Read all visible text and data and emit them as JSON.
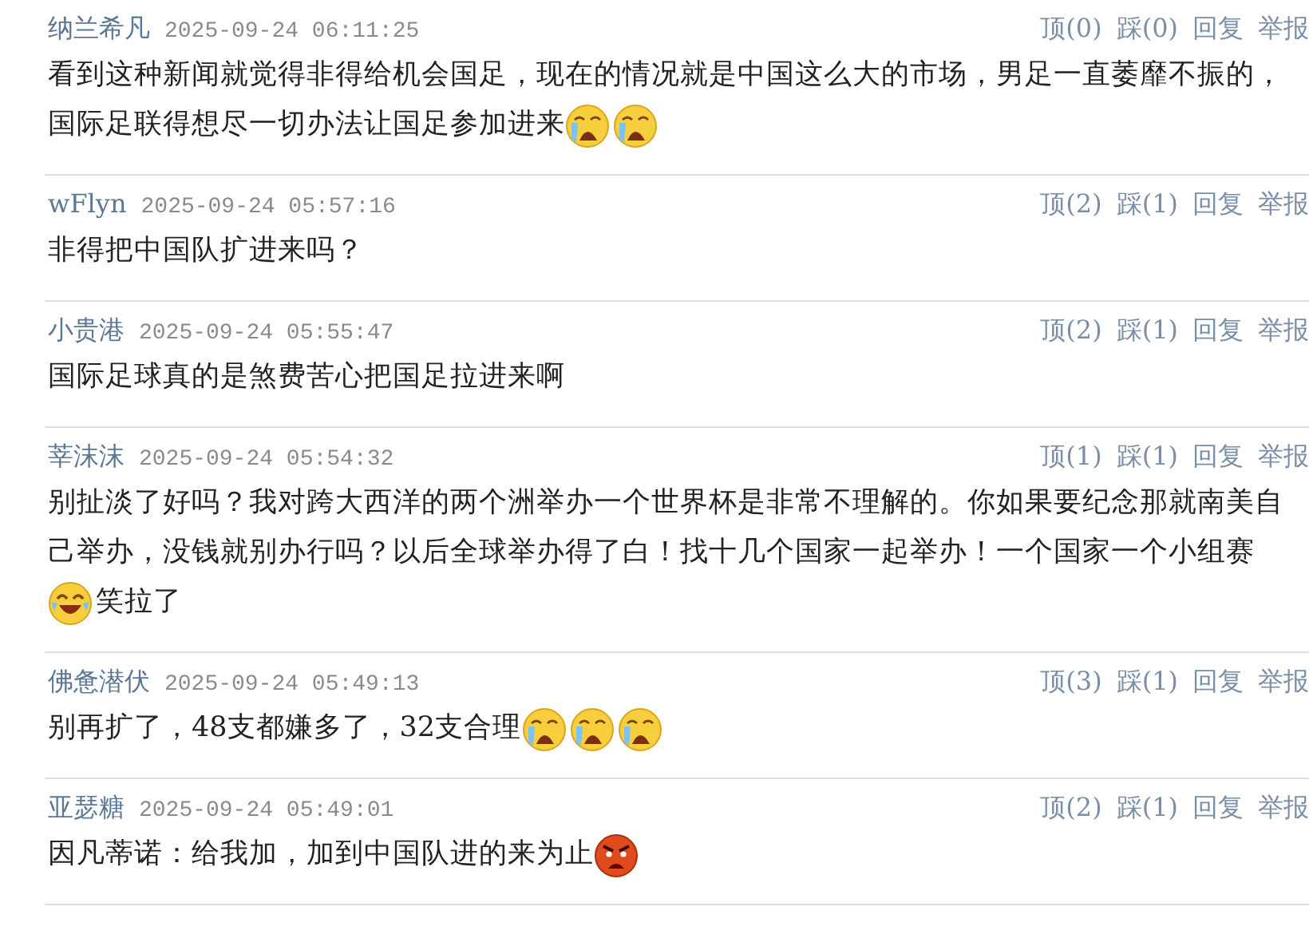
{
  "comments": [
    {
      "user": "纳兰希凡",
      "time": "2025-09-24 06:11:25",
      "actions": [
        "顶(0)",
        "踩(0)",
        "回复",
        "举报"
      ],
      "lines": [
        [
          {
            "kind": "text",
            "text": "看到这种新闻就觉得非得给机会国足，现在的情况就是中国这么大的市场，男足一直萎靡不振的，"
          }
        ],
        [
          {
            "kind": "text",
            "text": "国际足联得想尽一切办法让国足参加进来"
          },
          {
            "kind": "cry"
          },
          {
            "kind": "cry"
          }
        ]
      ]
    },
    {
      "user": "wFlyn",
      "time": "2025-09-24 05:57:16",
      "actions": [
        "顶(2)",
        "踩(1)",
        "回复",
        "举报"
      ],
      "lines": [
        [
          {
            "kind": "text",
            "text": "非得把中国队扩进来吗？"
          }
        ]
      ]
    },
    {
      "user": "小贵港",
      "time": "2025-09-24 05:55:47",
      "actions": [
        "顶(2)",
        "踩(1)",
        "回复",
        "举报"
      ],
      "lines": [
        [
          {
            "kind": "text",
            "text": "国际足球真的是煞费苦心把国足拉进来啊"
          }
        ]
      ]
    },
    {
      "user": "莘沫沫",
      "time": "2025-09-24 05:54:32",
      "actions": [
        "顶(1)",
        "踩(1)",
        "回复",
        "举报"
      ],
      "lines": [
        [
          {
            "kind": "text",
            "text": "别扯淡了好吗？我对跨大西洋的两个洲举办一个世界杯是非常不理解的。你如果要纪念那就南美自"
          }
        ],
        [
          {
            "kind": "text",
            "text": "己举办，没钱就别办行吗？以后全球举办得了白！找十几个国家一起举办！一个国家一个小组赛"
          }
        ],
        [
          {
            "kind": "laugh"
          },
          {
            "kind": "text",
            "text": "笑拉了"
          }
        ]
      ]
    },
    {
      "user": "佛惫潜伏",
      "time": "2025-09-24 05:49:13",
      "actions": [
        "顶(3)",
        "踩(1)",
        "回复",
        "举报"
      ],
      "lines": [
        [
          {
            "kind": "text",
            "text": "别再扩了，48支都嫌多了，32支合理"
          },
          {
            "kind": "cry"
          },
          {
            "kind": "cry"
          },
          {
            "kind": "cry"
          }
        ]
      ]
    },
    {
      "user": "亚瑟糖",
      "time": "2025-09-24 05:49:01",
      "actions": [
        "顶(2)",
        "踩(1)",
        "回复",
        "举报"
      ],
      "lines": [
        [
          {
            "kind": "text",
            "text": "因凡蒂诺：给我加，加到中国队进的来为止"
          },
          {
            "kind": "angry"
          }
        ]
      ]
    }
  ]
}
